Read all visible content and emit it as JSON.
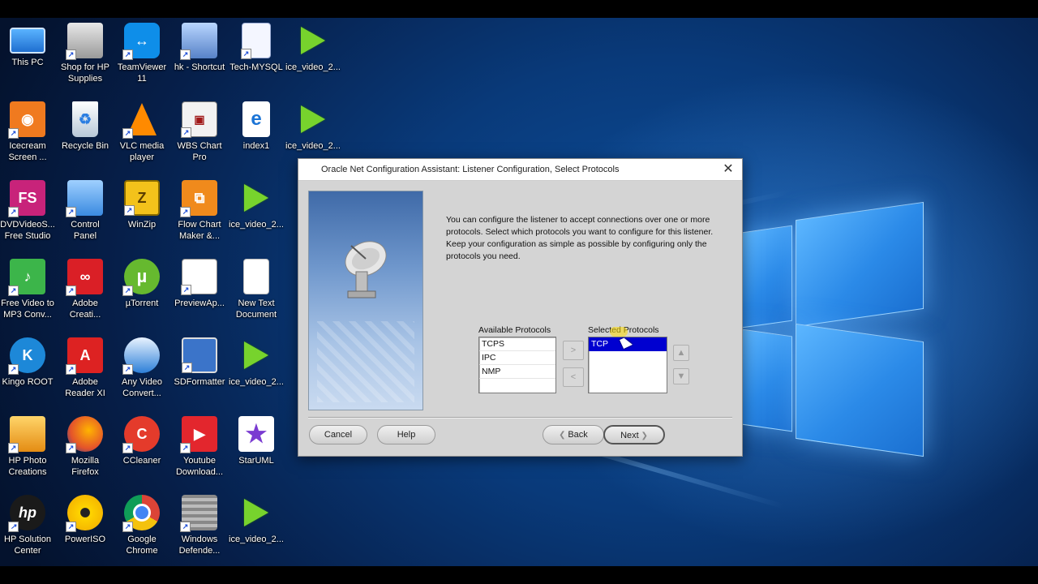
{
  "desktop": {
    "icons": [
      {
        "label": "This PC",
        "icon": "computer-icon"
      },
      {
        "label": "Shop for HP\nSupplies",
        "icon": "printer-icon"
      },
      {
        "label": "TeamViewer\n11",
        "icon": "teamviewer-icon"
      },
      {
        "label": "hk - Shortcut",
        "icon": "network-computer-icon"
      },
      {
        "label": "Tech-MYSQL",
        "icon": "document-icon"
      },
      {
        "label": "ice_video_2...",
        "icon": "play-video-icon"
      },
      {
        "label": "Icecream\nScreen ...",
        "icon": "icecream-icon"
      },
      {
        "label": "Recycle Bin",
        "icon": "recycle-bin-icon"
      },
      {
        "label": "VLC media\nplayer",
        "icon": "vlc-cone-icon"
      },
      {
        "label": "WBS Chart\nPro",
        "icon": "wbs-chart-icon"
      },
      {
        "label": "index1",
        "icon": "edge-html-icon"
      },
      {
        "label": "ice_video_2...",
        "icon": "play-video-icon"
      },
      {
        "label": "DVDVideoS...\nFree Studio",
        "icon": "fs-studio-icon"
      },
      {
        "label": "Control\nPanel",
        "icon": "control-panel-icon"
      },
      {
        "label": "WinZip",
        "icon": "winzip-icon"
      },
      {
        "label": "Flow Chart\nMaker &...",
        "icon": "flowchart-icon"
      },
      {
        "label": "ice_video_2...",
        "icon": "play-video-icon"
      },
      {
        "label": "Free Video to\nMP3 Conv...",
        "icon": "mp3-converter-icon"
      },
      {
        "label": "Adobe\nCreati...",
        "icon": "adobe-cc-icon"
      },
      {
        "label": "µTorrent",
        "icon": "utorrent-icon"
      },
      {
        "label": "PreviewAp...",
        "icon": "preview-doc-icon"
      },
      {
        "label": "New Text\nDocument",
        "icon": "text-file-icon"
      },
      {
        "label": "Kingo ROOT",
        "icon": "kingo-root-icon"
      },
      {
        "label": "Adobe\nReader XI",
        "icon": "adobe-reader-icon"
      },
      {
        "label": "Any Video\nConvert...",
        "icon": "video-converter-icon"
      },
      {
        "label": "SDFormatter",
        "icon": "sdformatter-icon"
      },
      {
        "label": "ice_video_2...",
        "icon": "play-video-icon"
      },
      {
        "label": "HP Photo\nCreations",
        "icon": "hp-photo-icon"
      },
      {
        "label": "Mozilla\nFirefox",
        "icon": "firefox-icon"
      },
      {
        "label": "CCleaner",
        "icon": "ccleaner-icon"
      },
      {
        "label": "Youtube\nDownload...",
        "icon": "youtube-downloader-icon"
      },
      {
        "label": "StarUML",
        "icon": "staruml-icon"
      },
      {
        "label": "HP Solution\nCenter",
        "icon": "hp-solution-icon"
      },
      {
        "label": "PowerISO",
        "icon": "poweriso-disc-icon"
      },
      {
        "label": "Google\nChrome",
        "icon": "chrome-icon"
      },
      {
        "label": "Windows\nDefende...",
        "icon": "windows-defender-icon"
      },
      {
        "label": "ice_video_2...",
        "icon": "play-video-icon"
      }
    ]
  },
  "dialog": {
    "title": "Oracle Net Configuration Assistant: Listener Configuration, Select Protocols",
    "description": "You can configure the listener to accept connections over one or more protocols. Select which protocols you want to configure for this listener. Keep your configuration as simple as possible by configuring only the protocols you need.",
    "available_label": "Available Protocols",
    "available": [
      "TCPS",
      "IPC",
      "NMP"
    ],
    "selected_label": "Selected Protocols",
    "selected": [
      "TCP"
    ],
    "buttons": {
      "cancel": "Cancel",
      "help": "Help",
      "back": "Back",
      "next": "Next",
      "add": ">",
      "remove": "<",
      "move_up": "▲",
      "move_down": "▼"
    }
  },
  "colors": {
    "selection": "#0000d0",
    "dialog_bg": "#d4d4d4",
    "desktop_blue": "#0d4f9c"
  }
}
